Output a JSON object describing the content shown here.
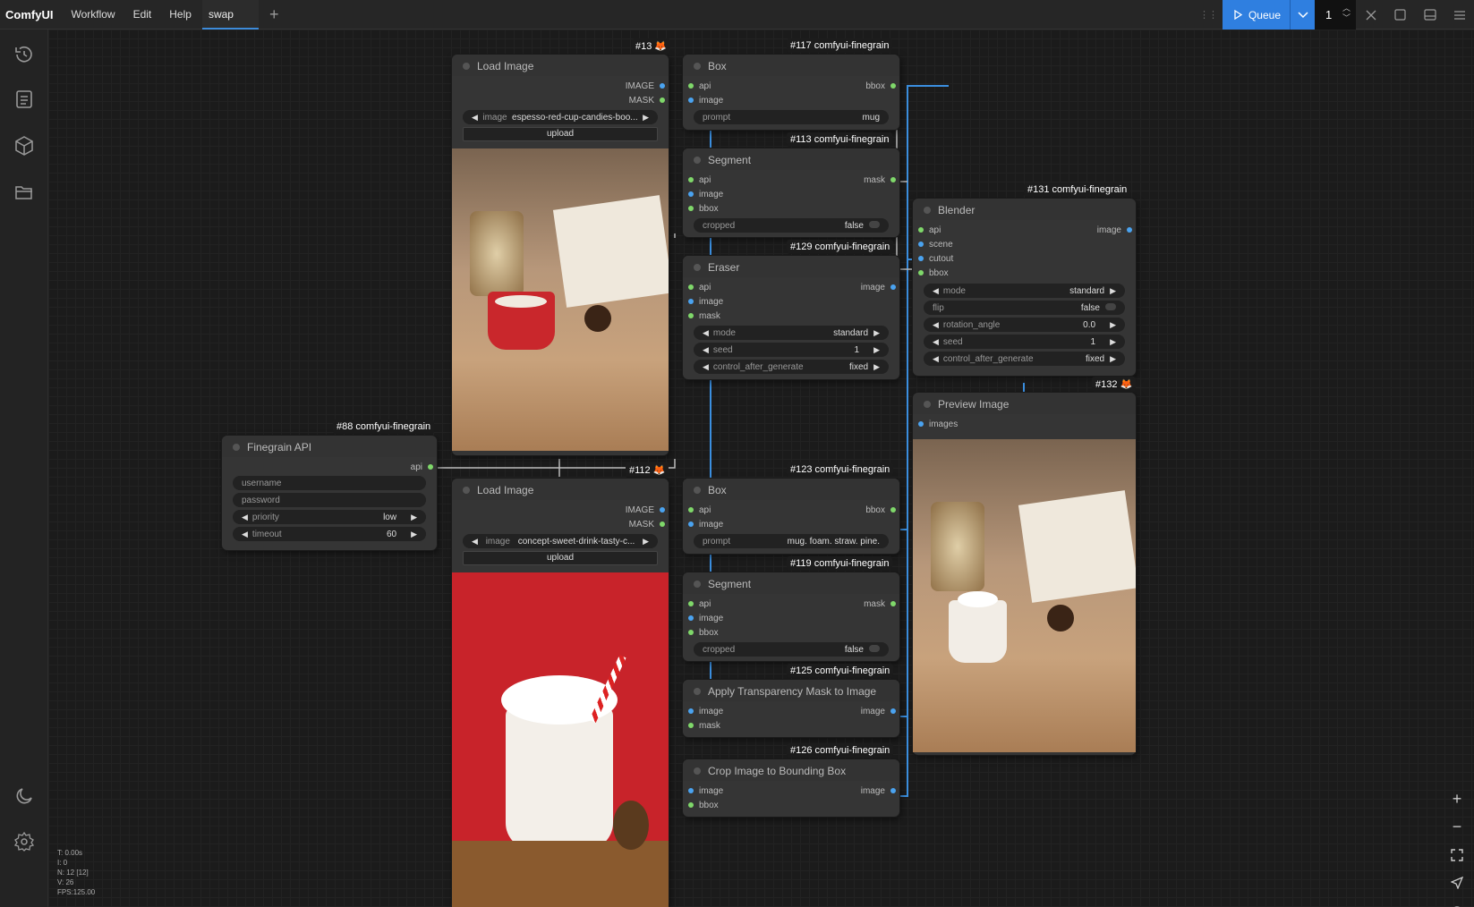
{
  "app": {
    "name": "ComfyUI"
  },
  "menu": [
    "Workflow",
    "Edit",
    "Help"
  ],
  "tabs": [
    {
      "label": "swap"
    }
  ],
  "queue": {
    "label": "Queue",
    "count": "1"
  },
  "stats": [
    "T: 0.00s",
    "I: 0",
    "N: 12 [12]",
    "V: 26",
    "FPS:125.00"
  ],
  "nodes": {
    "load1": {
      "badge": "#13",
      "title": "Load Image",
      "out1": "IMAGE",
      "out2": "MASK",
      "image_label": "image",
      "image_value": "espesso-red-cup-candies-boo...",
      "upload": "upload"
    },
    "box1": {
      "badge": "#117 comfyui-finegrain",
      "title": "Box",
      "in1": "api",
      "in2": "image",
      "out1": "bbox",
      "prompt_label": "prompt",
      "prompt_value": "mug"
    },
    "seg1": {
      "badge": "#113 comfyui-finegrain",
      "title": "Segment",
      "in1": "api",
      "in2": "image",
      "in3": "bbox",
      "out1": "mask",
      "cropped_label": "cropped",
      "cropped_value": "false"
    },
    "eraser": {
      "badge": "#129 comfyui-finegrain",
      "title": "Eraser",
      "in1": "api",
      "in2": "image",
      "in3": "mask",
      "out1": "image",
      "mode_label": "mode",
      "mode_value": "standard",
      "seed_label": "seed",
      "seed_value": "1",
      "cag_label": "control_after_generate",
      "cag_value": "fixed"
    },
    "blender": {
      "badge": "#131 comfyui-finegrain",
      "title": "Blender",
      "in1": "api",
      "in2": "scene",
      "in3": "cutout",
      "in4": "bbox",
      "out1": "image",
      "mode_label": "mode",
      "mode_value": "standard",
      "flip_label": "flip",
      "flip_value": "false",
      "rot_label": "rotation_angle",
      "rot_value": "0.0",
      "seed_label": "seed",
      "seed_value": "1",
      "cag_label": "control_after_generate",
      "cag_value": "fixed"
    },
    "preview": {
      "badge": "#132",
      "title": "Preview Image",
      "in1": "images"
    },
    "api": {
      "badge": "#88 comfyui-finegrain",
      "title": "Finegrain API",
      "out1": "api",
      "username": "username",
      "password": "password",
      "priority_label": "priority",
      "priority_value": "low",
      "timeout_label": "timeout",
      "timeout_value": "60"
    },
    "load2": {
      "badge": "#112",
      "title": "Load Image",
      "out1": "IMAGE",
      "out2": "MASK",
      "image_label": "image",
      "image_value": "concept-sweet-drink-tasty-c...",
      "upload": "upload"
    },
    "box2": {
      "badge": "#123 comfyui-finegrain",
      "title": "Box",
      "in1": "api",
      "in2": "image",
      "out1": "bbox",
      "prompt_label": "prompt",
      "prompt_value": "mug. foam. straw. pine."
    },
    "seg2": {
      "badge": "#119 comfyui-finegrain",
      "title": "Segment",
      "in1": "api",
      "in2": "image",
      "in3": "bbox",
      "out1": "mask",
      "cropped_label": "cropped",
      "cropped_value": "false"
    },
    "atm": {
      "badge": "#125 comfyui-finegrain",
      "title": "Apply Transparency Mask to Image",
      "in1": "image",
      "in2": "mask",
      "out1": "image"
    },
    "crop": {
      "badge": "#126 comfyui-finegrain",
      "title": "Crop Image to Bounding Box",
      "in1": "image",
      "in2": "bbox",
      "out1": "image"
    }
  },
  "colors": {
    "accent": "#2f7fe0",
    "link": "#3b8fe0",
    "slot_green": "#7fd86a",
    "slot_blue": "#4aa3f0"
  }
}
